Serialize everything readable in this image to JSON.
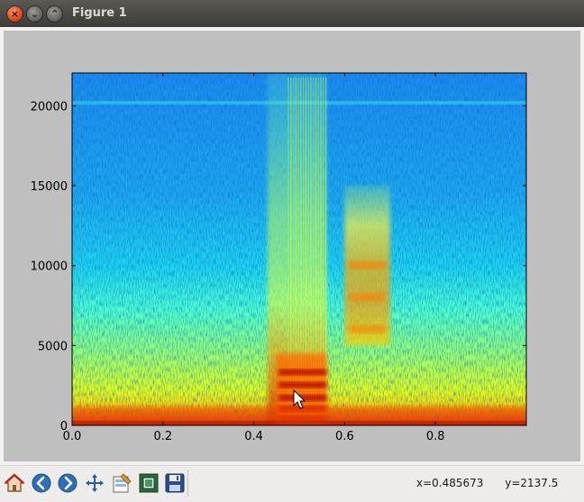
{
  "window": {
    "title": "Figure 1",
    "close_glyph": "×",
    "minimize_glyph": "⌄",
    "maximize_glyph": "⌃"
  },
  "toolbar": {
    "buttons": [
      {
        "name": "home-button",
        "icon": "home-icon"
      },
      {
        "name": "back-button",
        "icon": "back-arrow-icon"
      },
      {
        "name": "forward-button",
        "icon": "forward-arrow-icon"
      },
      {
        "name": "pan-button",
        "icon": "move-arrows-icon"
      },
      {
        "name": "configure-subplots-button",
        "icon": "configure-icon"
      },
      {
        "name": "zoom-rect-button",
        "icon": "zoom-rect-icon"
      },
      {
        "name": "save-button",
        "icon": "floppy-disk-icon"
      }
    ],
    "coord_x": "x=0.485673",
    "coord_y": "y=2137.5"
  },
  "chart_data": {
    "type": "heatmap",
    "title": "",
    "xlabel": "",
    "ylabel": "",
    "xlim": [
      0.0,
      1.0
    ],
    "ylim": [
      0,
      22050
    ],
    "xticks": [
      "0.0",
      "0.2",
      "0.4",
      "0.6",
      "0.8"
    ],
    "yticks": [
      "0",
      "5000",
      "10000",
      "15000",
      "20000"
    ],
    "colormap": "jet",
    "colors": {
      "low": "#1e66e6",
      "mid": "#33ddd6",
      "high": "#b20000"
    },
    "features": [
      {
        "label": "noise floor band",
        "x": [
          0.0,
          1.0
        ],
        "y": [
          0,
          1200
        ],
        "level": "high"
      },
      {
        "label": "broadband burst",
        "x": [
          0.43,
          0.56
        ],
        "y": [
          0,
          22050
        ],
        "level": "mid"
      },
      {
        "label": "harmonic stack",
        "x": [
          0.45,
          0.56
        ],
        "y": [
          0,
          4500
        ],
        "level": "very-high"
      },
      {
        "label": "sibilant band",
        "x": [
          0.6,
          0.7
        ],
        "y": [
          5000,
          15000
        ],
        "level": "high"
      }
    ]
  }
}
